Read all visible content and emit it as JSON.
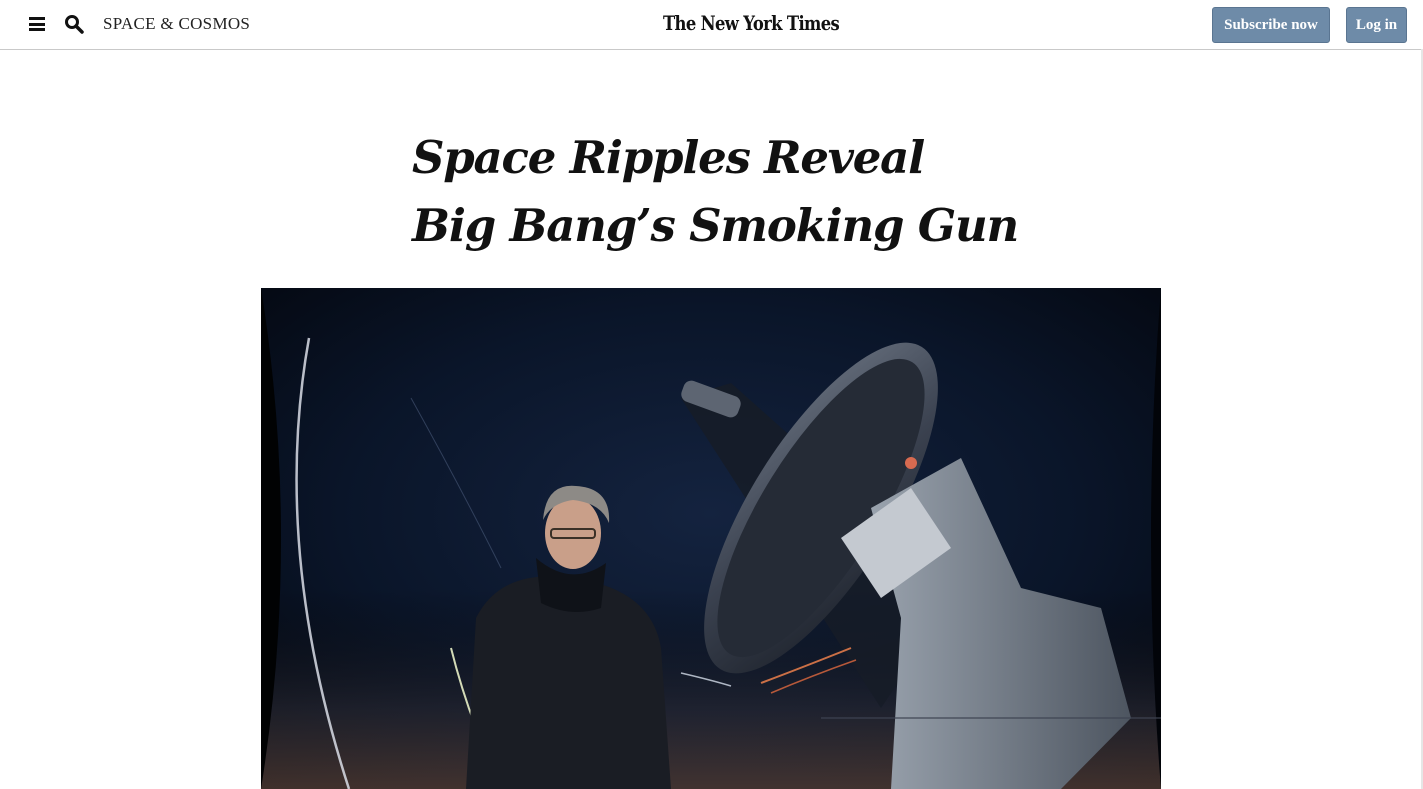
{
  "header": {
    "menu_icon": "hamburger-menu-icon",
    "search_icon": "search-icon",
    "section": "SPACE & COSMOS",
    "logo": "The New York Times",
    "subscribe_label": "Subscribe now",
    "login_label": "Log in",
    "button_color": "#6e8ba8"
  },
  "article": {
    "headline_line1": "Space Ripples Reveal",
    "headline_line2": "Big Bang’s Smoking Gun"
  },
  "colors": {
    "text": "#111111",
    "divider": "#c9c9c9",
    "photo_sky": "#0a1428"
  }
}
